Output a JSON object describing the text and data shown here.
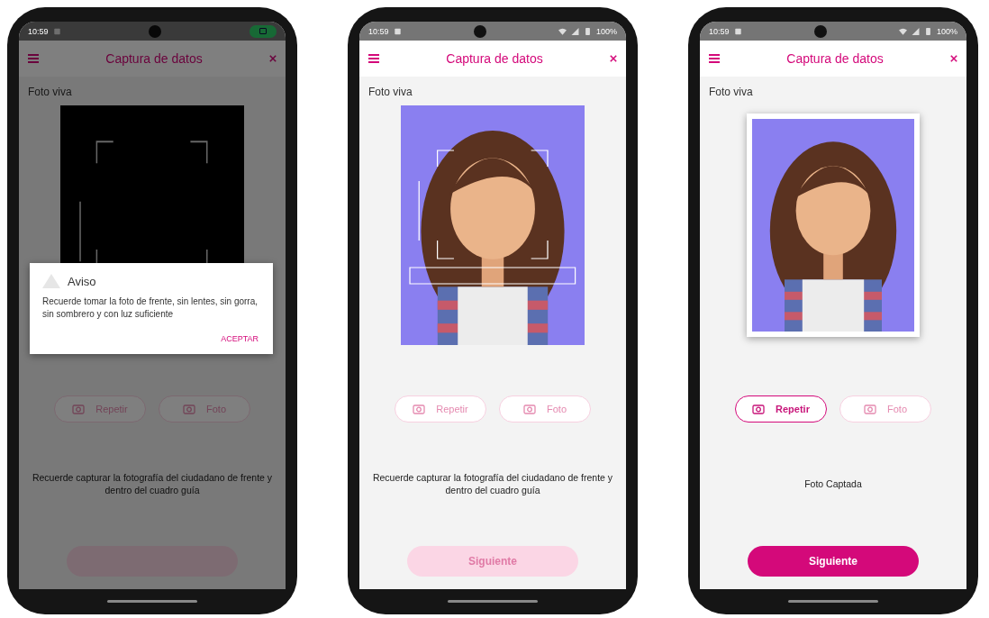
{
  "phones": [
    {
      "status_bar": {
        "time": "10:59",
        "recording": true
      },
      "header": {
        "title": "Captura de datos"
      },
      "section_label": "Foto viva",
      "preview": {
        "kind": "camera",
        "guide": true
      },
      "buttons": [
        {
          "label": "Repetir",
          "disabled": true
        },
        {
          "label": "Foto",
          "disabled": true
        }
      ],
      "note": "Recuerde capturar la fotografía del ciudadano de frente y dentro del cuadro guía",
      "next_button": {
        "disabled": true
      },
      "dialog": {
        "title": "Aviso",
        "body": "Recuerde tomar la foto de frente, sin lentes, sin gorra, sin sombrero y con luz suficiente",
        "action": "ACEPTAR"
      }
    },
    {
      "status_bar": {
        "time": "10:59",
        "recording": false,
        "battery": "100%"
      },
      "header": {
        "title": "Captura de datos"
      },
      "section_label": "Foto viva",
      "preview": {
        "kind": "live",
        "guide": true
      },
      "buttons": [
        {
          "label": "Repetir",
          "disabled": true
        },
        {
          "label": "Foto",
          "disabled": true
        }
      ],
      "note": "Recuerde capturar la fotografía del ciudadano de frente y dentro del cuadro guía",
      "next_button": {
        "label": "Siguiente",
        "disabled": true
      }
    },
    {
      "status_bar": {
        "time": "10:59",
        "recording": false,
        "battery": "100%"
      },
      "header": {
        "title": "Captura de datos"
      },
      "section_label": "Foto viva",
      "preview": {
        "kind": "captured",
        "guide": false
      },
      "buttons": [
        {
          "label": "Repetir",
          "disabled": false
        },
        {
          "label": "Foto",
          "disabled": true
        }
      ],
      "note": "Foto Captada",
      "next_button": {
        "label": "Siguiente",
        "disabled": false
      }
    }
  ]
}
